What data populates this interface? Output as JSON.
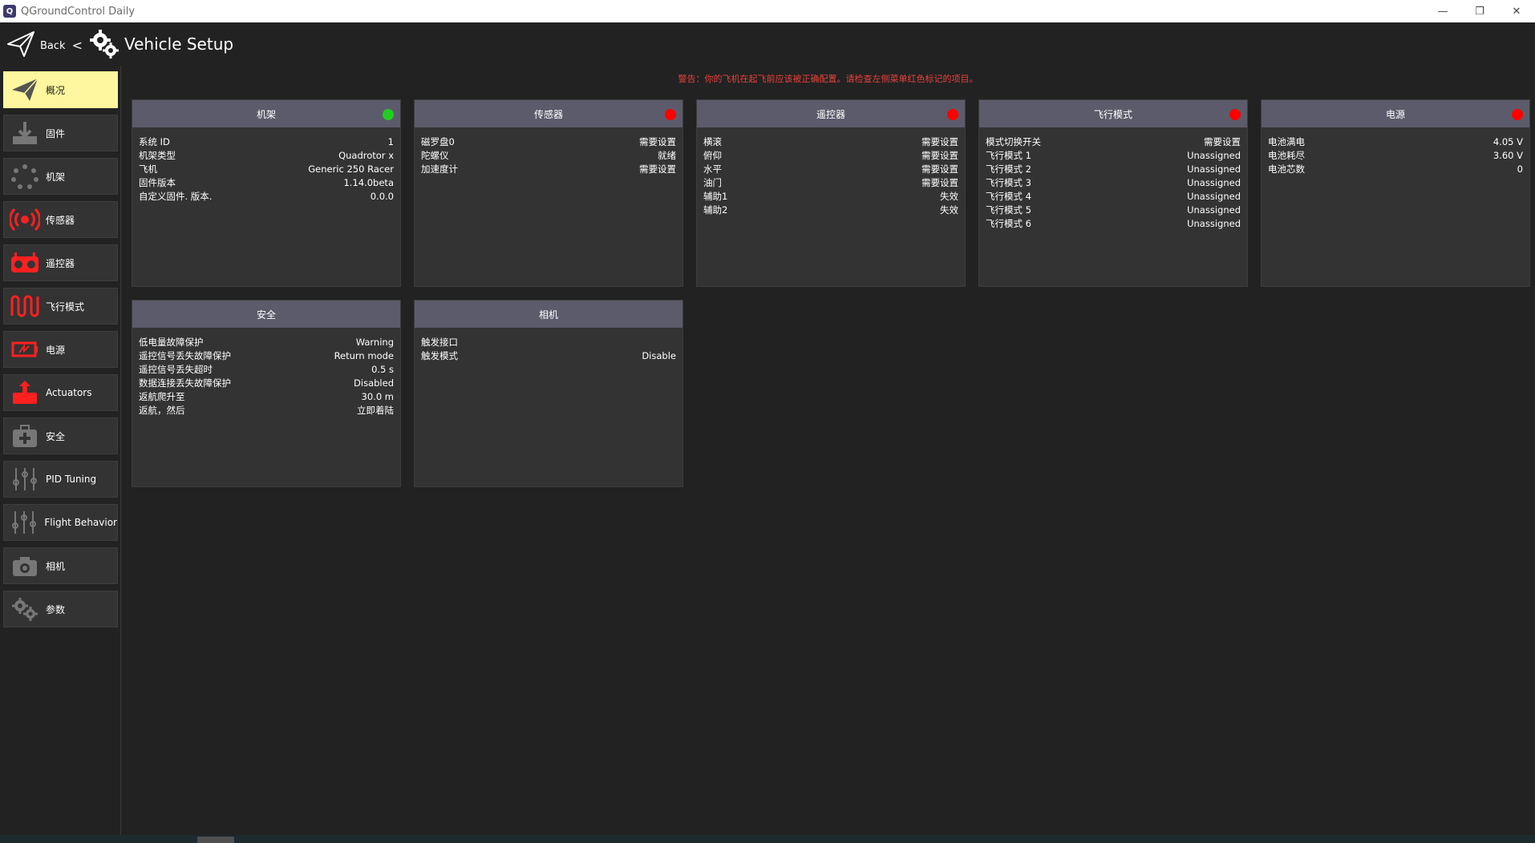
{
  "window": {
    "title": "QGroundControl Daily",
    "minimize": "—",
    "restore": "❐",
    "close": "✕"
  },
  "header": {
    "back_label": "Back",
    "back_chevron": "<",
    "page_title": "Vehicle Setup"
  },
  "warning": "警告：你的飞机在起飞前应该被正确配置。请检查左侧菜单红色标记的项目。",
  "sidebar": {
    "items": [
      {
        "label": "概况",
        "icon": "plane-icon",
        "active": true
      },
      {
        "label": "固件",
        "icon": "download-icon",
        "active": false
      },
      {
        "label": "机架",
        "icon": "frame-icon",
        "active": false
      },
      {
        "label": "传感器",
        "icon": "sensor-icon",
        "active": false
      },
      {
        "label": "遥控器",
        "icon": "radio-icon",
        "active": false
      },
      {
        "label": "飞行模式",
        "icon": "flight-mode-icon",
        "active": false
      },
      {
        "label": "电源",
        "icon": "battery-icon",
        "active": false
      },
      {
        "label": "Actuators",
        "icon": "actuator-icon",
        "active": false
      },
      {
        "label": "安全",
        "icon": "safety-icon",
        "active": false
      },
      {
        "label": "PID Tuning",
        "icon": "sliders-icon",
        "active": false
      },
      {
        "label": "Flight Behavior",
        "icon": "sliders-icon",
        "active": false
      },
      {
        "label": "相机",
        "icon": "camera-icon",
        "active": false
      },
      {
        "label": "参数",
        "icon": "gears-icon",
        "active": false
      }
    ]
  },
  "cards": [
    {
      "title": "机架",
      "status": "green",
      "rows": [
        {
          "k": "系统 ID",
          "v": "1"
        },
        {
          "k": "机架类型",
          "v": "Quadrotor x"
        },
        {
          "k": "飞机",
          "v": "Generic 250 Racer"
        },
        {
          "k": "固件版本",
          "v": "1.14.0beta"
        },
        {
          "k": "自定义固件. 版本.",
          "v": "0.0.0"
        }
      ]
    },
    {
      "title": "传感器",
      "status": "red",
      "rows": [
        {
          "k": "磁罗盘0",
          "v": "需要设置"
        },
        {
          "k": "陀螺仪",
          "v": "就绪"
        },
        {
          "k": "加速度计",
          "v": "需要设置"
        }
      ]
    },
    {
      "title": "遥控器",
      "status": "red",
      "rows": [
        {
          "k": "横滚",
          "v": "需要设置"
        },
        {
          "k": "俯仰",
          "v": "需要设置"
        },
        {
          "k": "水平",
          "v": "需要设置"
        },
        {
          "k": "油门",
          "v": "需要设置"
        },
        {
          "k": "辅助1",
          "v": "失效"
        },
        {
          "k": "辅助2",
          "v": "失效"
        }
      ]
    },
    {
      "title": "飞行模式",
      "status": "red",
      "rows": [
        {
          "k": "模式切换开关",
          "v": "需要设置"
        },
        {
          "k": "飞行模式 1",
          "v": "Unassigned"
        },
        {
          "k": "飞行模式 2",
          "v": "Unassigned"
        },
        {
          "k": "飞行模式 3",
          "v": "Unassigned"
        },
        {
          "k": "飞行模式 4",
          "v": "Unassigned"
        },
        {
          "k": "飞行模式 5",
          "v": "Unassigned"
        },
        {
          "k": "飞行模式 6",
          "v": "Unassigned"
        }
      ]
    },
    {
      "title": "电源",
      "status": "red",
      "rows": [
        {
          "k": "电池满电",
          "v": "4.05 V"
        },
        {
          "k": "电池耗尽",
          "v": "3.60 V"
        },
        {
          "k": "电池芯数",
          "v": "0"
        }
      ]
    },
    {
      "title": "安全",
      "status": "none",
      "rows": [
        {
          "k": "低电量故障保护",
          "v": "Warning"
        },
        {
          "k": "遥控信号丢失故障保护",
          "v": "Return mode"
        },
        {
          "k": "遥控信号丢失超时",
          "v": "0.5 s"
        },
        {
          "k": "数据连接丢失故障保护",
          "v": "Disabled"
        },
        {
          "k": "返航爬升至",
          "v": "30.0 m"
        },
        {
          "k": "返航，然后",
          "v": "立即着陆"
        }
      ]
    },
    {
      "title": "相机",
      "status": "none",
      "rows": [
        {
          "k": "触发接口",
          "v": ""
        },
        {
          "k": "触发模式",
          "v": "Disable"
        }
      ]
    }
  ],
  "colors": {
    "accent": "#fef79f",
    "status_green": "#22cc22",
    "status_red": "#ff0000",
    "warning_text": "#e8413b",
    "card_header": "#5b5b6b"
  }
}
